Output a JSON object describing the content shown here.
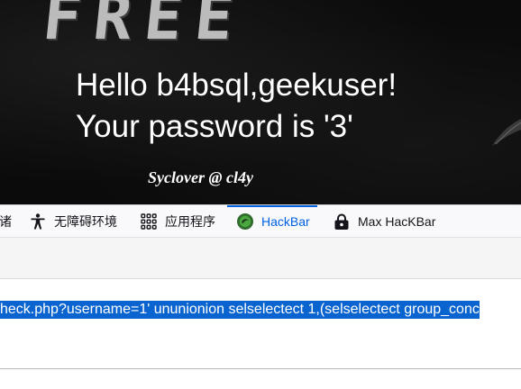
{
  "webpage": {
    "background_word": "FREE",
    "greeting_line1": "Hello b4bsql,geekuser!",
    "greeting_line2": "Your password is '3'",
    "signature": "Syclover @ cl4y"
  },
  "devtools_tabs": [
    {
      "label": "诸",
      "icon": "storage-icon"
    },
    {
      "label": "无障碍环境",
      "icon": "accessibility-icon"
    },
    {
      "label": "应用程序",
      "icon": "grid-icon"
    },
    {
      "label": "HackBar",
      "icon": "hackbar-icon",
      "active": true
    },
    {
      "label": "Max HacKBar",
      "icon": "lock-icon"
    }
  ],
  "hackbar": {
    "url_value": "heck.php?username=1' ununionion selselectect 1,(selselectect group_conc"
  },
  "colors": {
    "active_tab": "#0061e0",
    "selection": "#0a64cf",
    "banner_bg": "#0b0b0b"
  }
}
